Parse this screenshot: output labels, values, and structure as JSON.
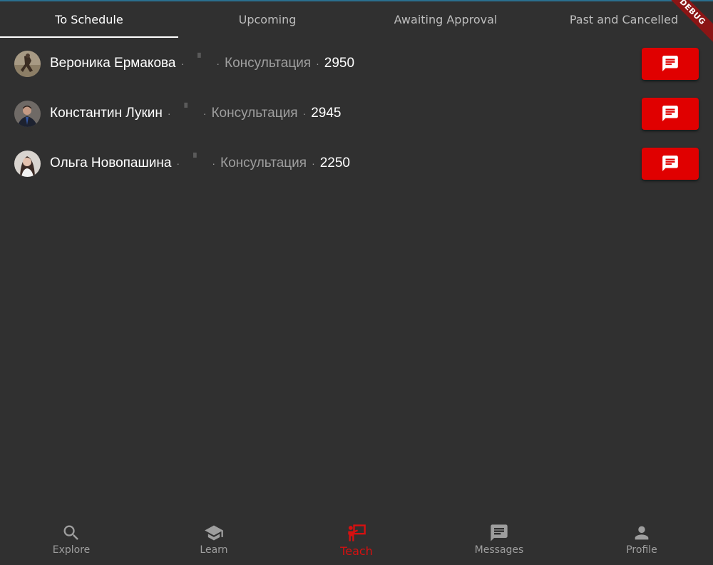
{
  "tabs": [
    {
      "label": "To Schedule",
      "active": true
    },
    {
      "label": "Upcoming",
      "active": false
    },
    {
      "label": "Awaiting Approval",
      "active": false
    },
    {
      "label": "Past and Cancelled",
      "active": false
    }
  ],
  "debug_banner": "DEBUG",
  "rows": [
    {
      "name": "Вероника Ермакова",
      "type": "Консультация",
      "price": "2950",
      "avatar_icon": "user-photo"
    },
    {
      "name": "Константин Лукин",
      "type": "Консультация",
      "price": "2945",
      "avatar_icon": "user-photo"
    },
    {
      "name": "Ольга Новопашина",
      "type": "Консультация",
      "price": "2250",
      "avatar_icon": "user-photo"
    }
  ],
  "separator": "·",
  "message_button_icon": "chat-icon",
  "bottom_nav": [
    {
      "label": "Explore",
      "icon": "search-icon",
      "active": false
    },
    {
      "label": "Learn",
      "icon": "graduation-cap-icon",
      "active": false
    },
    {
      "label": "Teach",
      "icon": "teacher-board-icon",
      "active": true
    },
    {
      "label": "Messages",
      "icon": "message-icon",
      "active": false
    },
    {
      "label": "Profile",
      "icon": "person-icon",
      "active": false
    }
  ],
  "colors": {
    "background": "#303030",
    "accent": "#e00000",
    "active_nav": "#d71010",
    "inactive": "#9e9e9e",
    "debug_ribbon": "#8b1515"
  }
}
